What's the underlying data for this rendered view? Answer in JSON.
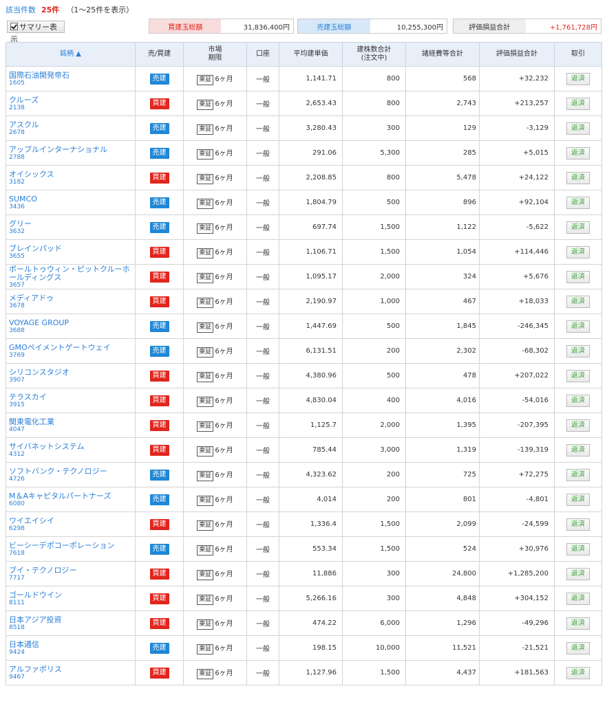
{
  "header": {
    "count_label": "該当件数",
    "count_value": "25件",
    "range_text": "（1〜25件を表示）",
    "summary_button": "サマリー表示"
  },
  "summary": {
    "buy_total_label": "買建玉総額",
    "buy_total_value": "31,836,400円",
    "sell_total_label": "売建玉総額",
    "sell_total_value": "10,255,300円",
    "eval_total_label": "評価損益合計",
    "eval_total_value": "+1,761,728円"
  },
  "table": {
    "headers": {
      "name": "銘柄 ▲",
      "side": "売/買建",
      "market1": "市場",
      "market2": "期限",
      "account": "口座",
      "avg_price": "平均建単価",
      "qty1": "建株数合計",
      "qty2": "(注文中)",
      "cost": "諸経費等合計",
      "pl": "評価損益合計",
      "trade": "取引"
    },
    "market_label": "東証",
    "term_label": "6ヶ月",
    "account_label": "一般",
    "close_label": "返済",
    "rows": [
      {
        "name": "国際石油開発帝石",
        "code": "1605",
        "side": "売建",
        "avg": "1,141.71",
        "qty": "800",
        "cost": "568",
        "pl": "+32,232"
      },
      {
        "name": "クルーズ",
        "code": "2138",
        "side": "買建",
        "avg": "2,653.43",
        "qty": "800",
        "cost": "2,743",
        "pl": "+213,257"
      },
      {
        "name": "アスクル",
        "code": "2678",
        "side": "売建",
        "avg": "3,280.43",
        "qty": "300",
        "cost": "129",
        "pl": "-3,129"
      },
      {
        "name": "アップルインターナショナル",
        "code": "2788",
        "side": "売建",
        "avg": "291.06",
        "qty": "5,300",
        "cost": "285",
        "pl": "+5,015"
      },
      {
        "name": "オイシックス",
        "code": "3182",
        "side": "買建",
        "avg": "2,208.85",
        "qty": "800",
        "cost": "5,478",
        "pl": "+24,122"
      },
      {
        "name": "SUMCO",
        "code": "3436",
        "side": "売建",
        "avg": "1,804.79",
        "qty": "500",
        "cost": "896",
        "pl": "+92,104"
      },
      {
        "name": "グリー",
        "code": "3632",
        "side": "売建",
        "avg": "697.74",
        "qty": "1,500",
        "cost": "1,122",
        "pl": "-5,622"
      },
      {
        "name": "ブレインパッド",
        "code": "3655",
        "side": "買建",
        "avg": "1,106.71",
        "qty": "1,500",
        "cost": "1,054",
        "pl": "+114,446"
      },
      {
        "name": "ボールトゥウィン・ピットクルーホールディングス",
        "code": "3657",
        "side": "買建",
        "avg": "1,095.17",
        "qty": "2,000",
        "cost": "324",
        "pl": "+5,676"
      },
      {
        "name": "メディアドゥ",
        "code": "3678",
        "side": "買建",
        "avg": "2,190.97",
        "qty": "1,000",
        "cost": "467",
        "pl": "+18,033"
      },
      {
        "name": "VOYAGE GROUP",
        "code": "3688",
        "side": "売建",
        "avg": "1,447.69",
        "qty": "500",
        "cost": "1,845",
        "pl": "-246,345"
      },
      {
        "name": "GMOペイメントゲートウェイ",
        "code": "3769",
        "side": "売建",
        "avg": "6,131.51",
        "qty": "200",
        "cost": "2,302",
        "pl": "-68,302"
      },
      {
        "name": "シリコンスタジオ",
        "code": "3907",
        "side": "買建",
        "avg": "4,380.96",
        "qty": "500",
        "cost": "478",
        "pl": "+207,022"
      },
      {
        "name": "テラスカイ",
        "code": "3915",
        "side": "買建",
        "avg": "4,830.04",
        "qty": "400",
        "cost": "4,016",
        "pl": "-54,016"
      },
      {
        "name": "関東電化工業",
        "code": "4047",
        "side": "買建",
        "avg": "1,125.7",
        "qty": "2,000",
        "cost": "1,395",
        "pl": "-207,395"
      },
      {
        "name": "サイバネットシステム",
        "code": "4312",
        "side": "買建",
        "avg": "785.44",
        "qty": "3,000",
        "cost": "1,319",
        "pl": "-139,319"
      },
      {
        "name": "ソフトバンク・テクノロジー",
        "code": "4726",
        "side": "売建",
        "avg": "4,323.62",
        "qty": "200",
        "cost": "725",
        "pl": "+72,275"
      },
      {
        "name": "M＆Aキャピタルパートナーズ",
        "code": "6080",
        "side": "売建",
        "avg": "4,014",
        "qty": "200",
        "cost": "801",
        "pl": "-4,801"
      },
      {
        "name": "ワイエイシイ",
        "code": "6298",
        "side": "買建",
        "avg": "1,336.4",
        "qty": "1,500",
        "cost": "2,099",
        "pl": "-24,599"
      },
      {
        "name": "ビーシーデポコーポレーション",
        "code": "7618",
        "side": "売建",
        "avg": "553.34",
        "qty": "1,500",
        "cost": "524",
        "pl": "+30,976"
      },
      {
        "name": "ブイ・テクノロジー",
        "code": "7717",
        "side": "買建",
        "avg": "11,886",
        "qty": "300",
        "cost": "24,800",
        "pl": "+1,285,200"
      },
      {
        "name": "ゴールドウイン",
        "code": "8111",
        "side": "買建",
        "avg": "5,266.16",
        "qty": "300",
        "cost": "4,848",
        "pl": "+304,152"
      },
      {
        "name": "日本アジア投資",
        "code": "8518",
        "side": "買建",
        "avg": "474.22",
        "qty": "6,000",
        "cost": "1,296",
        "pl": "-49,296"
      },
      {
        "name": "日本通信",
        "code": "9424",
        "side": "売建",
        "avg": "198.15",
        "qty": "10,000",
        "cost": "11,521",
        "pl": "-21,521"
      },
      {
        "name": "アルファポリス",
        "code": "9467",
        "side": "買建",
        "avg": "1,127.96",
        "qty": "1,500",
        "cost": "4,437",
        "pl": "+181,563"
      }
    ]
  },
  "colors": {
    "buy": "#e0261d",
    "sell": "#1f87d6",
    "link": "#2a7fd8",
    "header_bg": "#e8eff9"
  }
}
